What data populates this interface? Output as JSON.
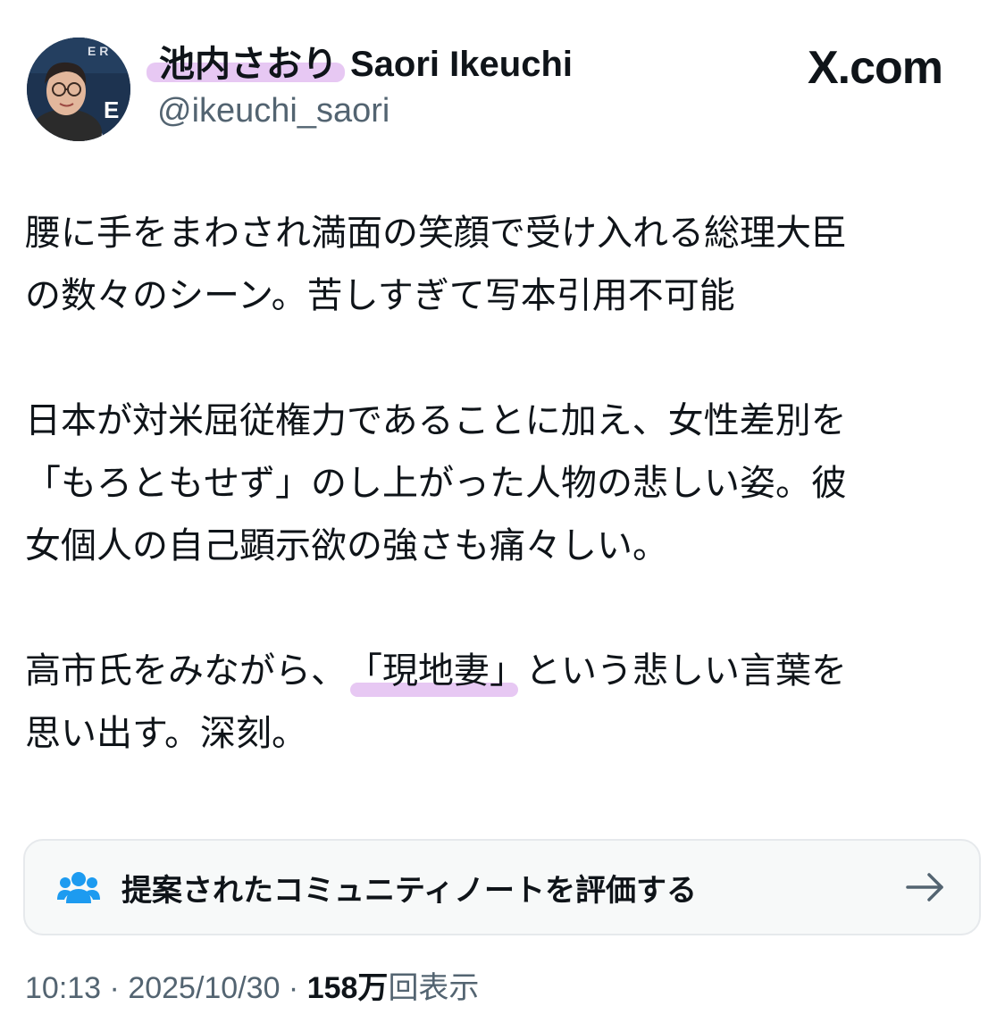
{
  "author": {
    "display_name_jp": "池内さおり",
    "display_name_en": "Saori Ikeuchi",
    "handle": "@ikeuchi_saori",
    "avatar_icon": "profile-photo"
  },
  "brand": {
    "label": "X.com",
    "icon": "x-logo-icon"
  },
  "tweet": {
    "paragraphs": [
      [
        "腰に手をまわされ満面の笑顔で受け入れる総理大臣",
        "の数々のシーン。苦しすぎて写本引用不可能"
      ],
      [
        "日本が対米屈従権力であることに加え、女性差別を",
        "「もろともせず」のし上がった人物の悲しい姿。彼",
        "女個人の自己顕示欲の強さも痛々しい。"
      ],
      [
        "思い出す。深刻。"
      ]
    ],
    "p3_line1_before": "高市氏をみながら、",
    "p3_line1_marked": "「現地妻」",
    "p3_line1_after": "という悲しい言葉を"
  },
  "community_note": {
    "label": "提案されたコミュニティノートを評価する",
    "icon": "people-icon",
    "arrow_icon": "arrow-right-icon"
  },
  "meta": {
    "time": "10:13",
    "separator": " · ",
    "date": "2025/10/30",
    "views_count": "158万",
    "views_label": "回表示"
  },
  "colors": {
    "highlight": "#e7c8f3",
    "accent_blue": "#1d9bf0",
    "secondary_text": "#536471"
  }
}
